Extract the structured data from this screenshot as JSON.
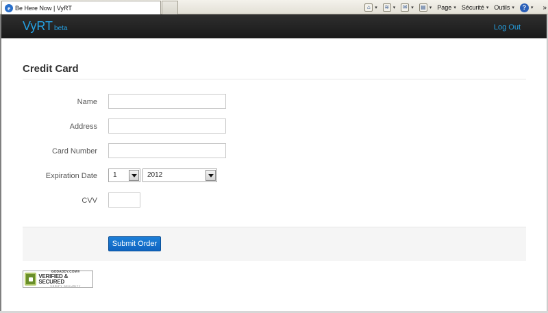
{
  "browser": {
    "tab_title": "Be Here Now | VyRT",
    "commands": {
      "page": "Page",
      "security": "Sécurité",
      "tools": "Outils"
    }
  },
  "nav": {
    "brand": "VyRT",
    "brand_sub": "beta",
    "logout": "Log Out"
  },
  "form": {
    "title": "Credit Card",
    "name_label": "Name",
    "name_value": "",
    "address_label": "Address",
    "address_value": "",
    "card_label": "Card Number",
    "card_value": "",
    "expiration_label": "Expiration Date",
    "exp_month": "1",
    "exp_year": "2012",
    "cvv_label": "CVV",
    "cvv_value": "",
    "submit": "Submit Order"
  },
  "seal": {
    "top": "GODADDY.COM®",
    "main": "VERIFIED & SECURED",
    "bottom": "VERIFY SECURITY"
  },
  "colors": {
    "accent": "#25a1e3",
    "button": "#1d7fd8",
    "navbar": "#222222"
  }
}
